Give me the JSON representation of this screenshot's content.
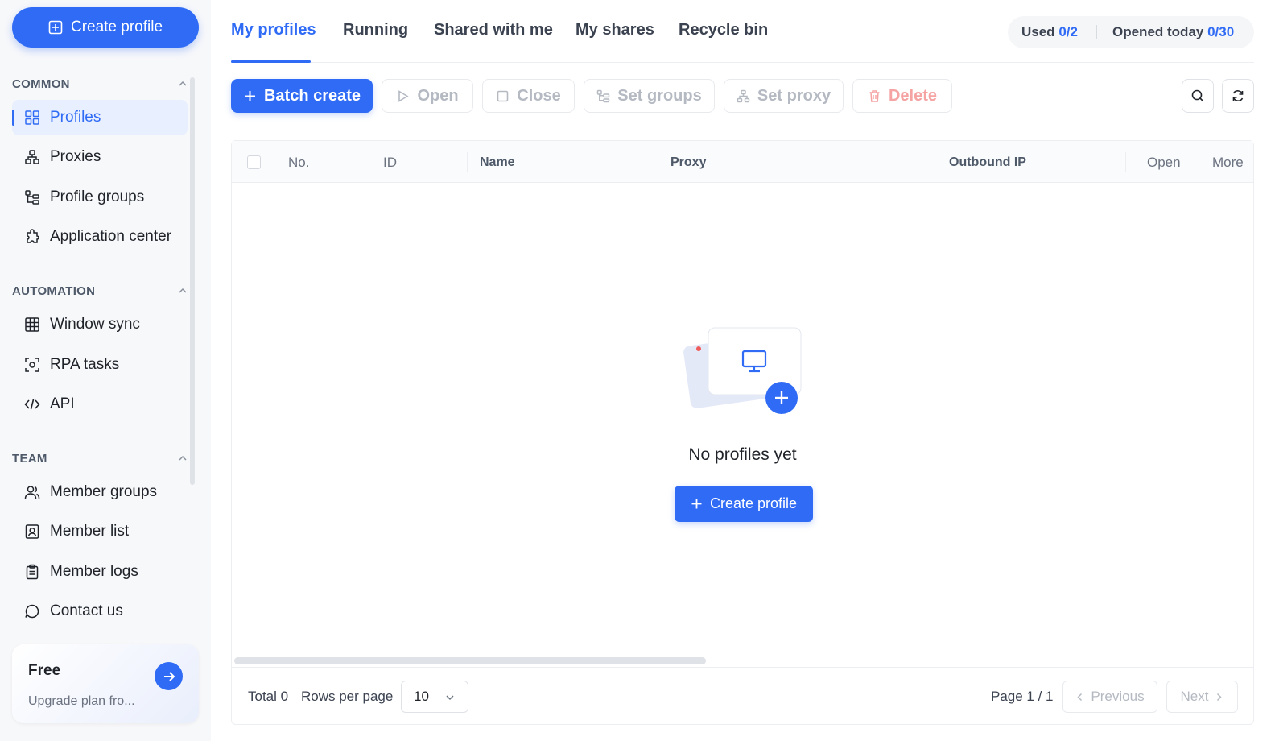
{
  "sidebar": {
    "create_label": "Create profile",
    "sections": {
      "common": "COMMON",
      "automation": "AUTOMATION",
      "team": "TEAM"
    },
    "items": {
      "profiles": "Profiles",
      "proxies": "Proxies",
      "profile_groups": "Profile groups",
      "application_center": "Application center",
      "window_sync": "Window sync",
      "rpa_tasks": "RPA tasks",
      "api": "API",
      "member_groups": "Member groups",
      "member_list": "Member list",
      "member_logs": "Member logs",
      "contact_us": "Contact us"
    },
    "plan": {
      "title": "Free",
      "subtitle": "Upgrade plan fro..."
    }
  },
  "tabs": {
    "my_profiles": "My profiles",
    "running": "Running",
    "shared_with_me": "Shared with me",
    "my_shares": "My shares",
    "recycle_bin": "Recycle bin"
  },
  "quota": {
    "used_label": "Used",
    "used_value": "0/2",
    "opened_label": "Opened today",
    "opened_value": "0/30"
  },
  "toolbar": {
    "batch_create": "Batch create",
    "open": "Open",
    "close": "Close",
    "set_groups": "Set groups",
    "set_proxy": "Set proxy",
    "delete": "Delete"
  },
  "table": {
    "columns": {
      "no": "No.",
      "id": "ID",
      "name": "Name",
      "proxy": "Proxy",
      "outbound_ip": "Outbound IP",
      "open": "Open",
      "more": "More"
    },
    "empty_text": "No profiles yet",
    "empty_create": "Create profile"
  },
  "footer": {
    "total": "Total 0",
    "rows_per_page_label": "Rows per page",
    "rows_per_page_value": "10",
    "page_info": "Page 1 / 1",
    "previous": "Previous",
    "next": "Next"
  },
  "colors": {
    "accent": "#2f6bf5",
    "danger_text": "#f5a3a3",
    "sidebar_bg": "#f7f8fa"
  }
}
